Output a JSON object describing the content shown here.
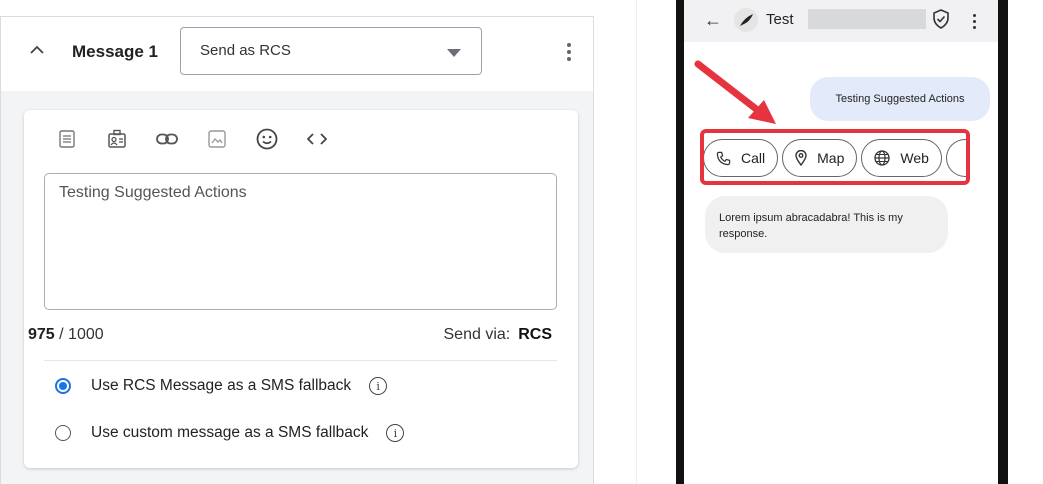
{
  "editor": {
    "message_title": "Message 1",
    "send_mode": "Send as RCS",
    "message_text": "Testing Suggested Actions",
    "counter_current": "975",
    "counter_total": " / 1000",
    "send_via_label": "Send via:",
    "send_via_value": "RCS",
    "fallback_options": [
      {
        "label": "Use RCS Message as a SMS fallback",
        "selected": true
      },
      {
        "label": "Use custom message as a SMS fallback",
        "selected": false
      }
    ],
    "info_glyph": "i",
    "toolbar_icons": [
      "template-icon",
      "contact-card-icon",
      "link-icon",
      "image-icon",
      "emoji-icon",
      "code-icon"
    ]
  },
  "phone": {
    "contact_name": "Test",
    "outgoing_message": "Testing Suggested Actions",
    "suggested_actions": [
      {
        "label": "Call",
        "icon": "phone-icon"
      },
      {
        "label": "Map",
        "icon": "map-pin-icon"
      },
      {
        "label": "Web",
        "icon": "globe-icon"
      }
    ],
    "incoming_message": "Lorem ipsum abracadabra! This is my response."
  },
  "colors": {
    "accent": "#1a73e8",
    "highlight": "#e5333f",
    "outgoing_bubble": "#e3ebfa",
    "incoming_bubble": "#f0f0f0"
  }
}
